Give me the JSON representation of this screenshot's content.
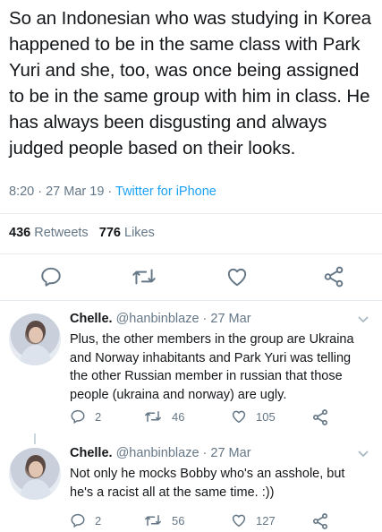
{
  "tweet": {
    "text": "So an Indonesian who was studying in Korea happened to be in the same class with Park Yuri and she, too, was once being assigned to be in the same group with him in class. He has always been disgusting and always judged people based on their looks.",
    "time": "8:20 · 27 Mar 19",
    "sep": " · ",
    "source": "Twitter for iPhone",
    "retweets_count": "436",
    "retweets_label": "Retweets",
    "likes_count": "776",
    "likes_label": "Likes"
  },
  "replies": [
    {
      "name": "Chelle.",
      "handle": "@hanbinblaze",
      "date": "· 27 Mar",
      "text": "Plus, the other members in the group are Ukraina and Norway inhabitants and Park Yuri was telling the other Russian member in russian that those people (ukraina and norway) are ugly.",
      "replies": "2",
      "retweets": "46",
      "likes": "105"
    },
    {
      "name": "Chelle.",
      "handle": "@hanbinblaze",
      "date": "· 27 Mar",
      "text": "Not only he mocks Bobby who's an asshole, but he's a racist all at the same time. :))",
      "replies": "2",
      "retweets": "56",
      "likes": "127"
    }
  ],
  "icons": [
    "reply-icon",
    "retweet-icon",
    "like-icon",
    "share-icon",
    "chevron-down-icon"
  ],
  "colors": {
    "link": "#1da1f2",
    "muted": "#657786",
    "text": "#14171a",
    "divider": "#e6ecf0"
  }
}
